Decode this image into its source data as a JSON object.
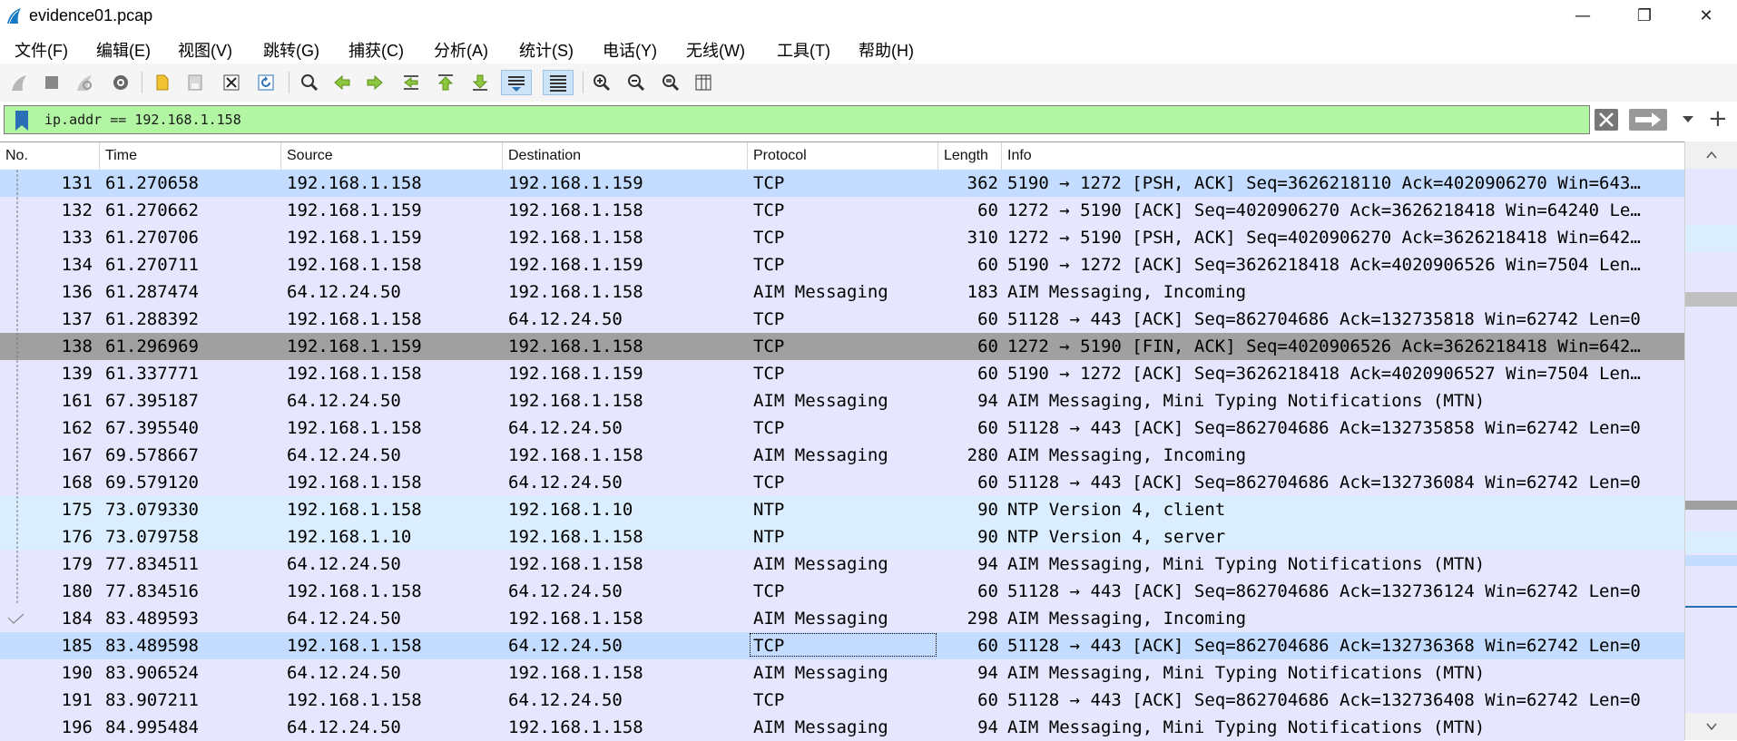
{
  "window": {
    "title": "evidence01.pcap"
  },
  "window_controls": {
    "minimize": "—",
    "restore": "❐",
    "close": "✕"
  },
  "menu": [
    "文件(F)",
    "编辑(E)",
    "视图(V)",
    "跳转(G)",
    "捕获(C)",
    "分析(A)",
    "统计(S)",
    "电话(Y)",
    "无线(W)",
    "工具(T)",
    "帮助(H)"
  ],
  "filter": {
    "value": "ip.addr == 192.168.1.158",
    "bg_color": "#b2f5a3"
  },
  "columns": [
    "No.",
    "Time",
    "Source",
    "Destination",
    "Protocol",
    "Length",
    "Info"
  ],
  "colors": {
    "tcp_row": "#e7e6ff",
    "http_row": "#e4ffc7",
    "udp_row": "#daeeff",
    "selected_row": "#a0a0a0",
    "focused_row": "#c3dcff"
  },
  "rows": [
    {
      "no": "131",
      "time": "61.270658",
      "src": "192.168.1.158",
      "dst": "192.168.1.159",
      "proto": "TCP",
      "len": "362",
      "info": "5190 → 1272 [PSH, ACK] Seq=3626218110 Ack=4020906270 Win=643…",
      "bg": "#c3dcff",
      "mark": "line"
    },
    {
      "no": "132",
      "time": "61.270662",
      "src": "192.168.1.159",
      "dst": "192.168.1.158",
      "proto": "TCP",
      "len": "60",
      "info": "1272 → 5190 [ACK] Seq=4020906270 Ack=3626218418 Win=64240 Le…",
      "bg": "#e7e6ff",
      "mark": "line"
    },
    {
      "no": "133",
      "time": "61.270706",
      "src": "192.168.1.159",
      "dst": "192.168.1.158",
      "proto": "TCP",
      "len": "310",
      "info": "1272 → 5190 [PSH, ACK] Seq=4020906270 Ack=3626218418 Win=642…",
      "bg": "#e7e6ff",
      "mark": "line"
    },
    {
      "no": "134",
      "time": "61.270711",
      "src": "192.168.1.158",
      "dst": "192.168.1.159",
      "proto": "TCP",
      "len": "60",
      "info": "5190 → 1272 [ACK] Seq=3626218418 Ack=4020906526 Win=7504 Len…",
      "bg": "#e7e6ff",
      "mark": "line"
    },
    {
      "no": "136",
      "time": "61.287474",
      "src": "64.12.24.50",
      "dst": "192.168.1.158",
      "proto": "AIM Messaging",
      "len": "183",
      "info": "AIM Messaging, Incoming",
      "bg": "#e7e6ff",
      "mark": "line"
    },
    {
      "no": "137",
      "time": "61.288392",
      "src": "192.168.1.158",
      "dst": "64.12.24.50",
      "proto": "TCP",
      "len": "60",
      "info": "51128 → 443 [ACK] Seq=862704686 Ack=132735818 Win=62742 Len=0",
      "bg": "#e7e6ff",
      "mark": "line"
    },
    {
      "no": "138",
      "time": "61.296969",
      "src": "192.168.1.159",
      "dst": "192.168.1.158",
      "proto": "TCP",
      "len": "60",
      "info": "1272 → 5190 [FIN, ACK] Seq=4020906526 Ack=3626218418 Win=642…",
      "bg": "#a0a0a0",
      "mark": "line"
    },
    {
      "no": "139",
      "time": "61.337771",
      "src": "192.168.1.158",
      "dst": "192.168.1.159",
      "proto": "TCP",
      "len": "60",
      "info": "5190 → 1272 [ACK] Seq=3626218418 Ack=4020906527 Win=7504 Len…",
      "bg": "#e7e6ff",
      "mark": "line"
    },
    {
      "no": "161",
      "time": "67.395187",
      "src": "64.12.24.50",
      "dst": "192.168.1.158",
      "proto": "AIM Messaging",
      "len": "94",
      "info": "AIM Messaging, Mini Typing Notifications (MTN)",
      "bg": "#e7e6ff",
      "mark": "line"
    },
    {
      "no": "162",
      "time": "67.395540",
      "src": "192.168.1.158",
      "dst": "64.12.24.50",
      "proto": "TCP",
      "len": "60",
      "info": "51128 → 443 [ACK] Seq=862704686 Ack=132735858 Win=62742 Len=0",
      "bg": "#e7e6ff",
      "mark": "line"
    },
    {
      "no": "167",
      "time": "69.578667",
      "src": "64.12.24.50",
      "dst": "192.168.1.158",
      "proto": "AIM Messaging",
      "len": "280",
      "info": "AIM Messaging, Incoming",
      "bg": "#e7e6ff",
      "mark": "line"
    },
    {
      "no": "168",
      "time": "69.579120",
      "src": "192.168.1.158",
      "dst": "64.12.24.50",
      "proto": "TCP",
      "len": "60",
      "info": "51128 → 443 [ACK] Seq=862704686 Ack=132736084 Win=62742 Len=0",
      "bg": "#e7e6ff",
      "mark": "line"
    },
    {
      "no": "175",
      "time": "73.079330",
      "src": "192.168.1.158",
      "dst": "192.168.1.10",
      "proto": "NTP",
      "len": "90",
      "info": "NTP Version 4, client",
      "bg": "#daeeff",
      "mark": "line"
    },
    {
      "no": "176",
      "time": "73.079758",
      "src": "192.168.1.10",
      "dst": "192.168.1.158",
      "proto": "NTP",
      "len": "90",
      "info": "NTP Version 4, server",
      "bg": "#daeeff",
      "mark": "line"
    },
    {
      "no": "179",
      "time": "77.834511",
      "src": "64.12.24.50",
      "dst": "192.168.1.158",
      "proto": "AIM Messaging",
      "len": "94",
      "info": "AIM Messaging, Mini Typing Notifications (MTN)",
      "bg": "#e7e6ff",
      "mark": "line"
    },
    {
      "no": "180",
      "time": "77.834516",
      "src": "192.168.1.158",
      "dst": "64.12.24.50",
      "proto": "TCP",
      "len": "60",
      "info": "51128 → 443 [ACK] Seq=862704686 Ack=132736124 Win=62742 Len=0",
      "bg": "#e7e6ff",
      "mark": "line"
    },
    {
      "no": "184",
      "time": "83.489593",
      "src": "64.12.24.50",
      "dst": "192.168.1.158",
      "proto": "AIM Messaging",
      "len": "298",
      "info": "AIM Messaging, Incoming",
      "bg": "#e7e6ff",
      "mark": "check"
    },
    {
      "no": "185",
      "time": "83.489598",
      "src": "192.168.1.158",
      "dst": "64.12.24.50",
      "proto": "TCP",
      "len": "60",
      "info": "51128 → 443 [ACK] Seq=862704686 Ack=132736368 Win=62742 Len=0",
      "bg": "#c3dcff",
      "mark": "none",
      "focused": true
    },
    {
      "no": "190",
      "time": "83.906524",
      "src": "64.12.24.50",
      "dst": "192.168.1.158",
      "proto": "AIM Messaging",
      "len": "94",
      "info": "AIM Messaging, Mini Typing Notifications (MTN)",
      "bg": "#e7e6ff",
      "mark": "none"
    },
    {
      "no": "191",
      "time": "83.907211",
      "src": "192.168.1.158",
      "dst": "64.12.24.50",
      "proto": "TCP",
      "len": "60",
      "info": "51128 → 443 [ACK] Seq=862704686 Ack=132736408 Win=62742 Len=0",
      "bg": "#e7e6ff",
      "mark": "none"
    },
    {
      "no": "196",
      "time": "84.995484",
      "src": "64.12.24.50",
      "dst": "192.168.1.158",
      "proto": "AIM Messaging",
      "len": "94",
      "info": "AIM Messaging, Mini Typing Notifications (MTN)",
      "bg": "#e7e6ff",
      "mark": "none"
    }
  ]
}
